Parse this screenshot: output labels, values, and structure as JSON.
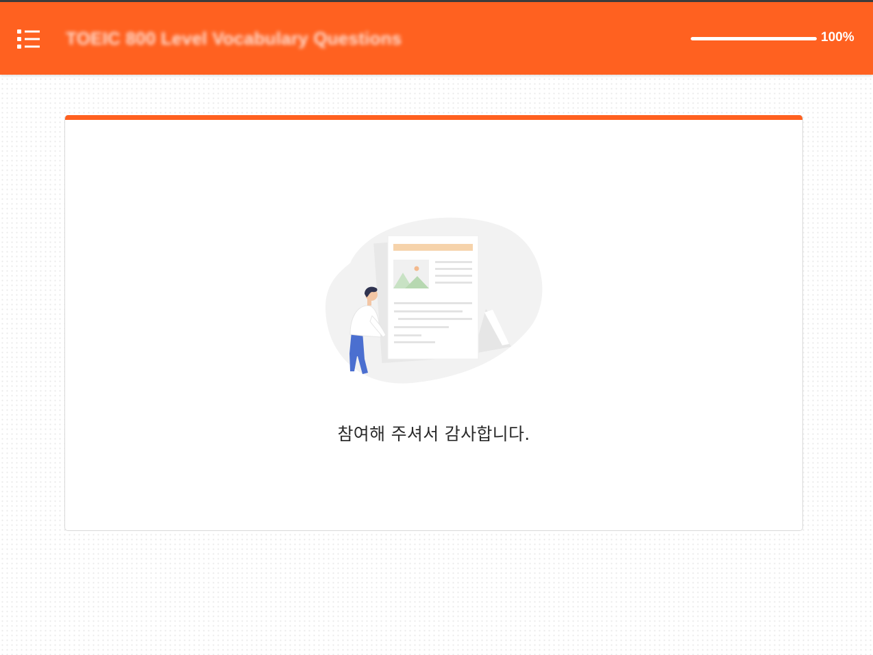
{
  "header": {
    "title": "TOEIC 800 Level Vocabulary Questions",
    "progress_percent": 100,
    "progress_text": "100%",
    "menu_icon": "list-menu-icon"
  },
  "completion": {
    "illustration": "document-review-illustration",
    "message": "참여해 주셔서 감사합니다."
  },
  "colors": {
    "accent": "#ff6120",
    "text": "#2a2a2a",
    "card_border": "#d9d9d9"
  }
}
